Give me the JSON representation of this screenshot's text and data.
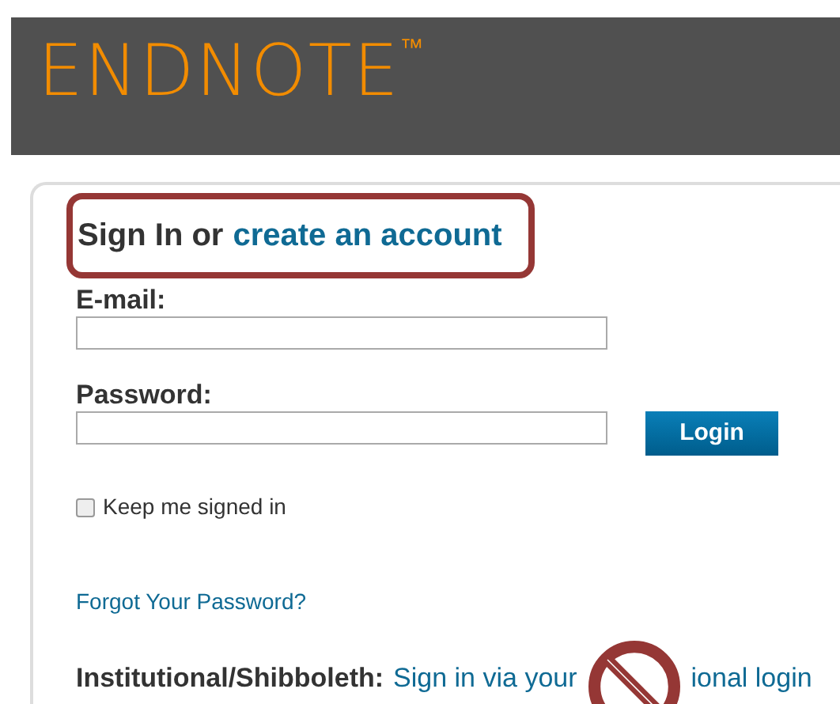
{
  "header": {
    "logo": "ENDNOTE",
    "trademark": "™"
  },
  "sign_in": {
    "heading": "Sign In or",
    "create_link": "create an account"
  },
  "email": {
    "label": "E-mail:"
  },
  "password": {
    "label": "Password:"
  },
  "login_button": "Login",
  "keep_signed_in": {
    "label": "Keep me signed in",
    "checked": false
  },
  "forgot_link": "Forgot Your Password?",
  "institutional": {
    "label": "Institutional/Shibboleth:",
    "link": "Sign in via your",
    "link_rest": "ional login"
  }
}
